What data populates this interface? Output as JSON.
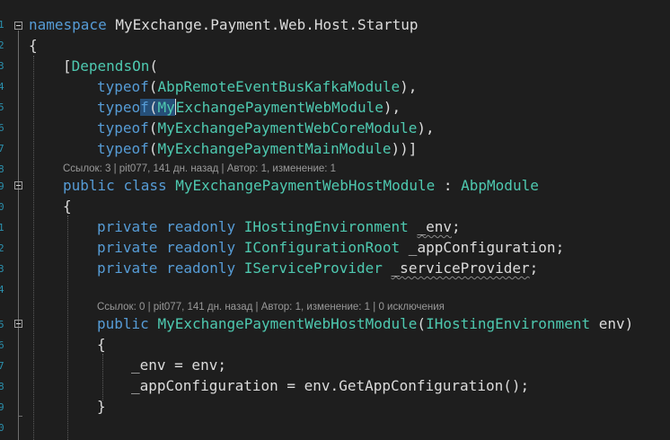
{
  "line_numbers": [
    "1",
    "2",
    "3",
    "4",
    "5",
    "6",
    "7",
    "8",
    "9",
    "0",
    "1",
    "2",
    "3",
    "4",
    "5",
    "6",
    "7",
    "8",
    "9",
    "0",
    "1",
    "2"
  ],
  "code": {
    "l1": {
      "kw": "namespace",
      "rest": " MyExchange.Payment.Web.Host.Startup"
    },
    "l2": {
      "text": "{"
    },
    "l3": {
      "bracket": "[",
      "attr": "DependsOn",
      "paren": "("
    },
    "l4": {
      "kw": "typeof",
      "open": "(",
      "type": "AbpRemoteEventBusKafkaModule",
      "close": "),"
    },
    "l5": {
      "kw_a": "typeo",
      "kw_b": "f",
      "open": "(",
      "type_sel": "My",
      "type": "ExchangePaymentWebModule",
      "close": "),"
    },
    "l6": {
      "kw": "typeof",
      "open": "(",
      "type": "MyExchangePaymentWebCoreModule",
      "close": "),"
    },
    "l7": {
      "kw": "typeof",
      "open": "(",
      "type": "MyExchangePaymentMainModule",
      "close": "))]"
    },
    "l8": {
      "kw1": "public",
      "kw2": "class",
      "name": "MyExchangePaymentWebHostModule",
      "colon": " : ",
      "base": "AbpModule"
    },
    "l9": {
      "text": "{"
    },
    "l10": {
      "kw1": "private",
      "kw2": "readonly",
      "type": "IHostingEnvironment",
      "sp": " ",
      "field": "_env",
      "end": ";"
    },
    "l11": {
      "kw1": "private",
      "kw2": "readonly",
      "type": "IConfigurationRoot",
      "field": " _appConfiguration;"
    },
    "l12": {
      "kw1": "private",
      "kw2": "readonly",
      "type": "IServiceProvider",
      "sp": " ",
      "field": "_serviceProvider",
      "end": ";"
    },
    "l13": {
      "kw": "public",
      "name": "MyExchangePaymentWebHostModule",
      "open": "(",
      "ptype": "IHostingEnvironment",
      "param": " env)"
    },
    "l14": {
      "text": "{"
    },
    "l15": {
      "text": "_env = env;"
    },
    "l16": {
      "text": "_appConfiguration = env.GetAppConfiguration();"
    },
    "l17": {
      "text": "}"
    }
  },
  "codelens": {
    "class_lens": {
      "refs": "Ссылок: 3",
      "sep1": " | ",
      "author_time": "pit077, 141 дн. назад",
      "sep2": " | ",
      "authors": "Автор: 1, изменение: 1"
    },
    "ctor_lens": {
      "refs": "Ссылок: 0",
      "sep1": " | ",
      "author_time": "pit077, 141 дн. назад",
      "sep2": " | ",
      "authors": "Автор: 1, изменение: 1",
      "sep3": " | ",
      "exceptions": "0 исключения"
    }
  },
  "colors": {
    "background": "#1e1e1e",
    "keyword": "#569cd6",
    "type": "#4ec9b0",
    "text": "#dcdcdc",
    "line_number": "#2b91af",
    "codelens": "#999999",
    "selection": "#264f78"
  },
  "icons": [
    "collapse-box-icon"
  ]
}
